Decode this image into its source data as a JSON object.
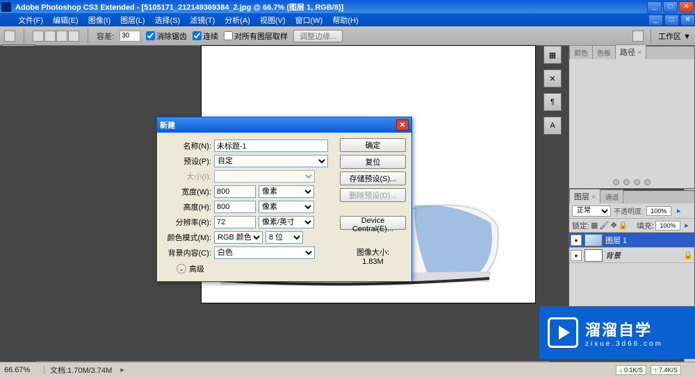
{
  "title": "Adobe Photoshop CS3 Extended - [5105171_212149369384_2.jpg @ 66.7% (图层 1, RGB/8)]",
  "menu": [
    "文件(F)",
    "编辑(E)",
    "图像(I)",
    "图层(L)",
    "选择(S)",
    "滤镜(T)",
    "分析(A)",
    "视图(V)",
    "窗口(W)",
    "帮助(H)"
  ],
  "options": {
    "tolerance_label": "容差:",
    "tolerance_value": "30",
    "antialias": "消除锯齿",
    "contiguous": "连续",
    "all_layers": "对所有图层取样",
    "refine_edge": "调整边缘...",
    "workspace_label": "工作区 ▼"
  },
  "panels": {
    "color_tabs": [
      "颜色",
      "色板",
      "路径"
    ],
    "layers_tabs": [
      "图层",
      "通道"
    ],
    "blend_mode": "正常",
    "opacity_label": "不透明度:",
    "opacity_value": "100%",
    "lock_label": "锁定:",
    "fill_label": "填充:",
    "fill_value": "100%",
    "layers": [
      {
        "name": "图层 1",
        "selected": true
      },
      {
        "name": "背景",
        "selected": false
      }
    ]
  },
  "dialog": {
    "title": "新建",
    "name_label": "名称(N):",
    "name_value": "未标题-1",
    "preset_label": "预设(P):",
    "preset_value": "自定",
    "size_label": "大小(I):",
    "width_label": "宽度(W):",
    "width_value": "800",
    "width_unit": "像素",
    "height_label": "高度(H):",
    "height_value": "800",
    "height_unit": "像素",
    "res_label": "分辨率(R):",
    "res_value": "72",
    "res_unit": "像素/英寸",
    "mode_label": "颜色模式(M):",
    "mode_value": "RGB 颜色",
    "depth_value": "8 位",
    "bg_label": "背景内容(C):",
    "bg_value": "白色",
    "adv_label": "高级",
    "imgsize_label": "图像大小:",
    "imgsize_value": "1.83M",
    "btn_ok": "确定",
    "btn_reset": "复位",
    "btn_save_preset": "存储预设(S)...",
    "btn_del_preset": "删除预设(D)...",
    "btn_device": "Device Central(E)..."
  },
  "status": {
    "zoom": "66.67%",
    "doc": "文档:1.70M/3.74M",
    "net1": "↓ 0.1K/S",
    "net2": "↑ 7.4K/S"
  },
  "watermark": {
    "big": "溜溜自学",
    "small": "zixue.3d66.com"
  },
  "icons": {
    "min": "_",
    "max": "□",
    "close": "✕",
    "ps": "Ps",
    "eye": "👁",
    "chev": "≫",
    "drop": "▸"
  }
}
